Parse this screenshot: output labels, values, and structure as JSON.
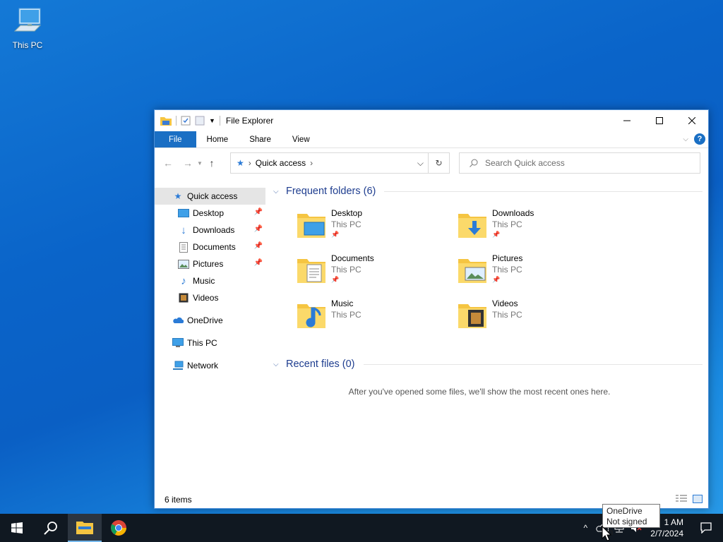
{
  "desktop": {
    "icons": [
      {
        "label": "This PC",
        "icon": "this-pc-icon"
      }
    ]
  },
  "window": {
    "title": "File Explorer",
    "ribbon_tabs": [
      "File",
      "Home",
      "Share",
      "View"
    ],
    "address": {
      "path": "Quick access"
    },
    "search": {
      "placeholder": "Search Quick access"
    },
    "sidebar": {
      "quick_access": "Quick access",
      "pinned": [
        {
          "label": "Desktop",
          "icon": "desktop-icon",
          "pinned": true
        },
        {
          "label": "Downloads",
          "icon": "downloads-icon",
          "pinned": true
        },
        {
          "label": "Documents",
          "icon": "documents-icon",
          "pinned": true
        },
        {
          "label": "Pictures",
          "icon": "pictures-icon",
          "pinned": true
        },
        {
          "label": "Music",
          "icon": "music-icon",
          "pinned": false
        },
        {
          "label": "Videos",
          "icon": "videos-icon",
          "pinned": false
        }
      ],
      "onedrive": "OneDrive",
      "this_pc": "This PC",
      "network": "Network"
    },
    "frequent": {
      "header": "Frequent folders (6)",
      "folders": [
        {
          "name": "Desktop",
          "location": "This PC",
          "pinned": true
        },
        {
          "name": "Downloads",
          "location": "This PC",
          "pinned": true
        },
        {
          "name": "Documents",
          "location": "This PC",
          "pinned": true
        },
        {
          "name": "Pictures",
          "location": "This PC",
          "pinned": true
        },
        {
          "name": "Music",
          "location": "This PC",
          "pinned": false
        },
        {
          "name": "Videos",
          "location": "This PC",
          "pinned": false
        }
      ]
    },
    "recent": {
      "header": "Recent files (0)",
      "empty_message": "After you've opened some files, we'll show the most recent ones here."
    },
    "status": {
      "items": "6 items"
    }
  },
  "taskbar": {
    "clock_time": "1 AM",
    "clock_date": "2/7/2024"
  },
  "tooltip": {
    "line1": "OneDrive",
    "line2": "Not signed in"
  },
  "colors": {
    "accent": "#1a6fc4",
    "section_header": "#1e3d8f",
    "folder": "#f5c542"
  }
}
